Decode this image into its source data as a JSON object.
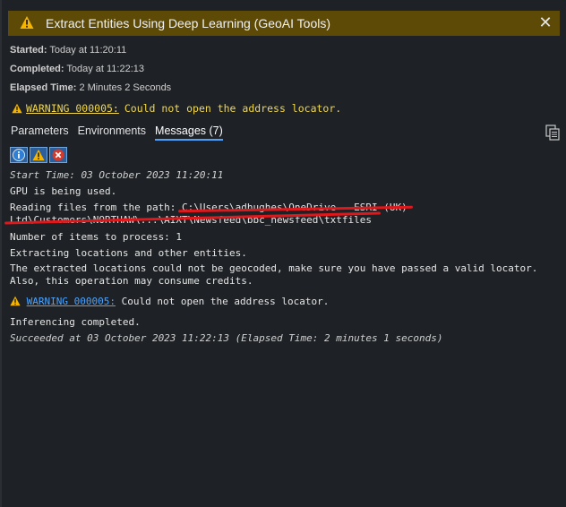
{
  "title": "Extract Entities Using Deep Learning (GeoAI Tools)",
  "close_glyph": "✕",
  "info": {
    "started_label": "Started:",
    "started_value": "Today at 11:20:11",
    "completed_label": "Completed:",
    "completed_value": "Today at 11:22:13",
    "elapsed_label": "Elapsed Time:",
    "elapsed_value": "2 Minutes 2 Seconds"
  },
  "top_warning": {
    "code": "WARNING 000005:",
    "message": "Could not open the address locator."
  },
  "tabs": [
    {
      "label": "Parameters"
    },
    {
      "label": "Environments"
    },
    {
      "label": "Messages (7)"
    }
  ],
  "messages": {
    "start_time": "Start Time: 03 October 2023 11:20:11",
    "gpu": "GPU is being used.",
    "reading_1": "Reading files from the path: C:\\Users\\adhughes\\OneDrive - ESRI (UK)",
    "reading_2": "Ltd\\Customers\\NORTHAW\\...\\AIXT\\Newsfeed\\bbc_newsfeed\\txtfiles",
    "items": "Number of items to process: 1",
    "extracting": "Extracting locations and other entities.",
    "geocode_1": "The extracted locations could not be geocoded, make sure you have passed a valid locator.",
    "geocode_2": "Also, this operation may consume credits.",
    "warning_code": "WARNING 000005:",
    "warning_msg": "Could not open the address locator.",
    "inferencing": "Inferencing completed.",
    "succeeded": "Succeeded at 03 October 2023 11:22:13 (Elapsed Time: 2 minutes 1 seconds)"
  },
  "colors": {
    "titlebar": "#5c4a06",
    "warning_text": "#f2d84a",
    "link": "#4aa3ff",
    "redaction": "#e0181c"
  }
}
